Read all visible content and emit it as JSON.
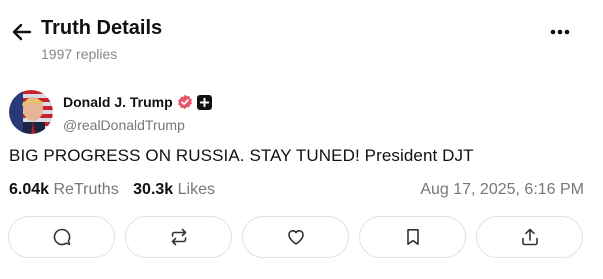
{
  "header": {
    "title": "Truth Details",
    "replies": "1997 replies",
    "back_icon": "arrow-left-icon",
    "more_icon": "ellipsis-icon"
  },
  "post": {
    "author_name": "Donald J. Trump",
    "handle": "@realDonaldTrump",
    "verified_icon": "verified-badge-icon",
    "verified_color": "#e8556b",
    "plus_icon": "plus-badge-icon",
    "text": "BIG PROGRESS ON RUSSIA. STAY TUNED! President DJT",
    "retruths_count": "6.04k",
    "retruths_label": "ReTruths",
    "likes_count": "30.3k",
    "likes_label": "Likes",
    "timestamp": "Aug 17, 2025, 6:16 PM"
  },
  "actions": [
    {
      "name": "reply",
      "icon": "comment-icon"
    },
    {
      "name": "retruth",
      "icon": "repost-icon"
    },
    {
      "name": "like",
      "icon": "heart-icon"
    },
    {
      "name": "bookmark",
      "icon": "bookmark-icon"
    },
    {
      "name": "share",
      "icon": "share-icon"
    }
  ]
}
